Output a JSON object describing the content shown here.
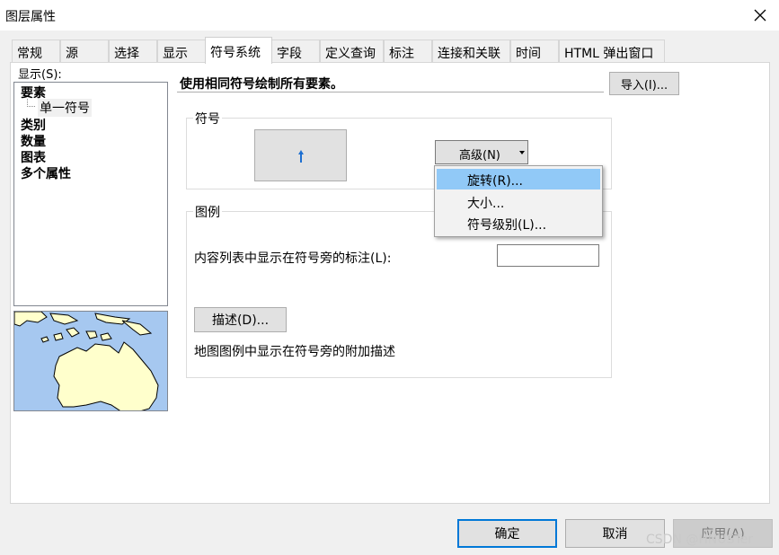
{
  "window": {
    "title": "图层属性"
  },
  "tabs": [
    {
      "label": "常规"
    },
    {
      "label": "源"
    },
    {
      "label": "选择"
    },
    {
      "label": "显示"
    },
    {
      "label": "符号系统"
    },
    {
      "label": "字段"
    },
    {
      "label": "定义查询"
    },
    {
      "label": "标注"
    },
    {
      "label": "连接和关联"
    },
    {
      "label": "时间"
    },
    {
      "label": "HTML 弹出窗口"
    }
  ],
  "show": {
    "label": "显示(S):",
    "items": [
      "要素",
      "单一符号",
      "类别",
      "数量",
      "图表",
      "多个属性"
    ]
  },
  "header": {
    "text": "使用相同符号绘制所有要素。"
  },
  "import_button": {
    "label": "导入(I)..."
  },
  "symbol_group": {
    "label": "符号",
    "advanced_label": "高级(N)"
  },
  "advanced_menu": {
    "items": [
      "旋转(R)...",
      "大小...",
      "符号级别(L)..."
    ]
  },
  "legend_group": {
    "label": "图例",
    "toc_label": "内容列表中显示在符号旁的标注(L):",
    "toc_value": "",
    "describe_button": "描述(D)...",
    "describe_hint": "地图图例中显示在符号旁的附加描述"
  },
  "buttons": {
    "ok": "确定",
    "cancel": "取消",
    "apply": "应用(A)"
  },
  "watermark": "CSDN @HNUSTer",
  "colors": {
    "accent": "#0078d7",
    "menu_highlight": "#91c9f7",
    "sea": "#a6c8f0",
    "land": "#ffffcc",
    "symbol": "#1d6fd1"
  }
}
